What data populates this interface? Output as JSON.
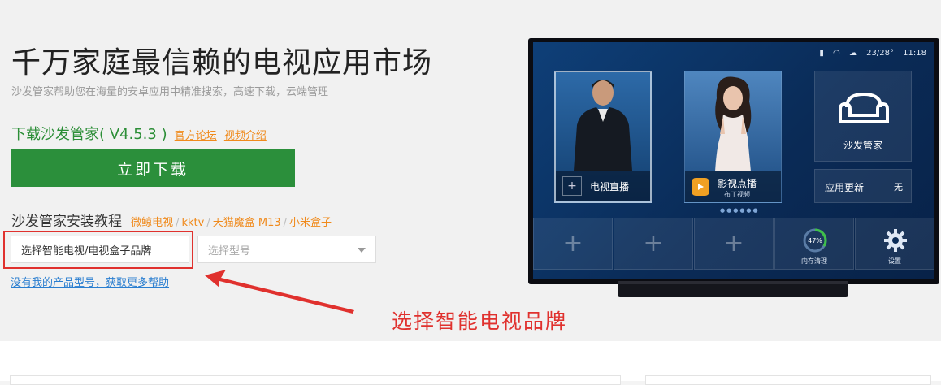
{
  "hero": {
    "title": "千万家庭最信赖的电视应用市场",
    "subtitle": "沙发管家帮助您在海量的安卓应用中精准搜索，高速下载，云端管理"
  },
  "download": {
    "label": "下载沙发管家( V4.5.3 )",
    "links": [
      "官方论坛",
      "视频介绍"
    ],
    "button_label": "立即下载",
    "button_color": "#2b8f3b"
  },
  "tutorial": {
    "label": "沙发管家安装教程",
    "links": [
      "微鲸电视",
      "kktv",
      "天猫魔盒 M13",
      "小米盒子"
    ],
    "link_separator": "/"
  },
  "selects": {
    "brand_value": "选择智能电视/电视盒子品牌",
    "model_placeholder": "选择型号"
  },
  "help_link": "没有我的产品型号，获取更多帮助",
  "annotation": {
    "text": "选择智能电视品牌",
    "color": "#e0312e"
  },
  "tv": {
    "status": {
      "temp": "23/28°",
      "time": "11:18"
    },
    "tiles": {
      "live": "电视直播",
      "vod": "影视点播",
      "vod_sub": "布丁视频",
      "sofa": "沙发管家",
      "update": "应用更新",
      "update_badge": "无",
      "memory_pct": "47%",
      "memory": "内存清理",
      "settings": "设置"
    }
  }
}
